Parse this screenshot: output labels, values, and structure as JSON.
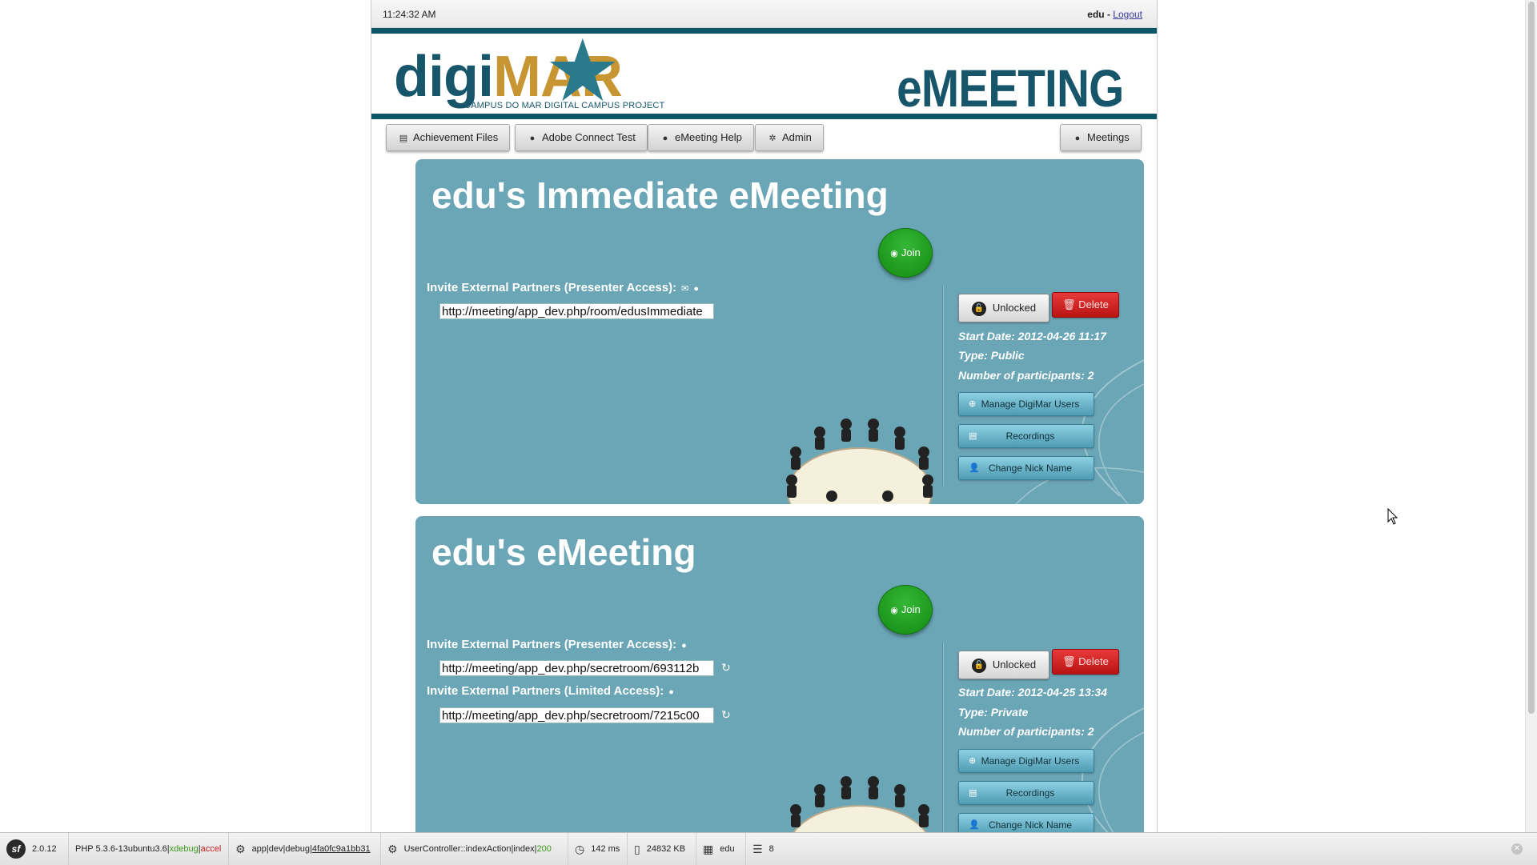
{
  "topbar": {
    "time": "11:24:32 AM",
    "user": "edu",
    "separator": " - ",
    "logout": "Logout"
  },
  "logo": {
    "part1": "digi",
    "part2": "MAR",
    "tagline": "CAMPUS DO MAR DIGITAL CAMPUS PROJECT"
  },
  "brand": "eMEETING",
  "nav": {
    "achievement": "Achievement Files",
    "adobe": "Adobe Connect Test",
    "help": "eMeeting Help",
    "admin": "Admin",
    "meetings": "Meetings"
  },
  "meetings": [
    {
      "title": "edu's Immediate eMeeting",
      "join": "Join",
      "presenter_label": "Invite External Partners (Presenter Access):",
      "presenter_url": "http://meeting/app_dev.php/room/edusImmediate",
      "lock": "Unlocked",
      "delete": "Delete",
      "start_date": "Start Date: 2012-04-26 11:17",
      "type": "Type: Public",
      "participants": "Number of participants: 2",
      "manage": "Manage DigiMar Users",
      "recordings": "Recordings",
      "nickname": "Change Nick Name"
    },
    {
      "title": "edu's eMeeting",
      "join": "Join",
      "presenter_label": "Invite External Partners (Presenter Access):",
      "presenter_url": "http://meeting/app_dev.php/secretroom/693112b",
      "limited_label": "Invite External Partners (Limited Access):",
      "limited_url": "http://meeting/app_dev.php/secretroom/7215c00",
      "lock": "Unlocked",
      "delete": "Delete",
      "start_date": "Start Date: 2012-04-25 13:34",
      "type": "Type: Private",
      "participants": "Number of participants: 2",
      "manage": "Manage DigiMar Users",
      "recordings": "Recordings",
      "nickname": "Change Nick Name"
    }
  ],
  "debug_toolbar": {
    "symfony_version": "2.0.12",
    "php": "PHP 5.3.6-13ubuntu3.6",
    "xdebug": "xdebug",
    "accel": "accel",
    "app": "app",
    "env": "dev",
    "debug": "debug",
    "token": "4fa0fc9a1bb31",
    "controller": "UserController::indexAction",
    "route": "index",
    "status": "200",
    "time": "142 ms",
    "memory": "24832 KB",
    "user": "edu",
    "queries": "8"
  },
  "colors": {
    "panel": "#6ba6b7",
    "band": "#0e5767",
    "brand": "#16556a",
    "gold": "#c79632",
    "join": "#1f9e1f",
    "delete": "#c81c1c"
  }
}
